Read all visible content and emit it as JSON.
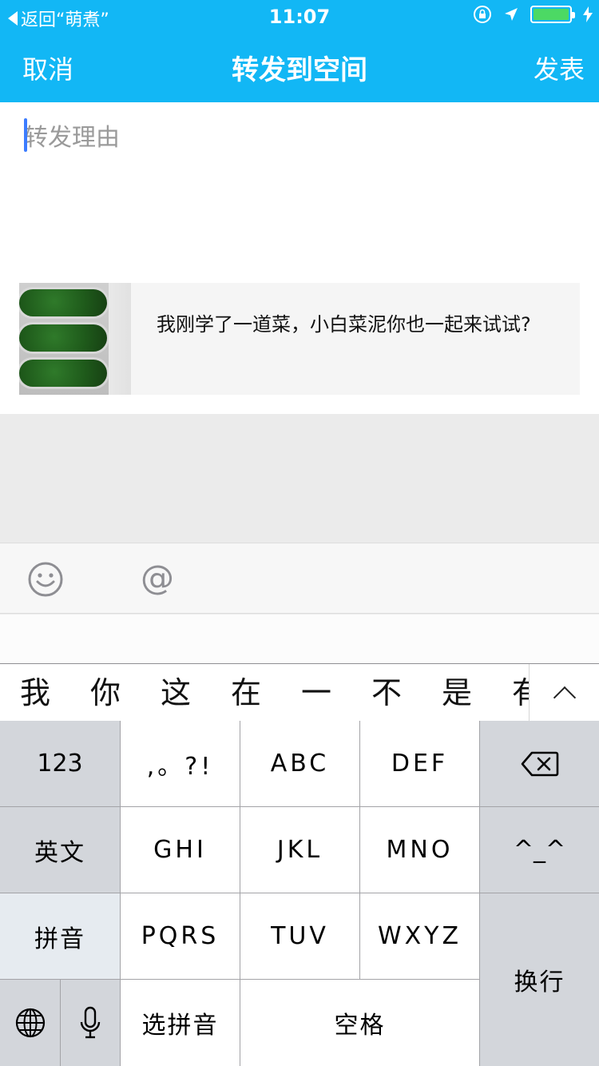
{
  "status_bar": {
    "back_label": "返回“萌煮”",
    "time": "11:07",
    "battery_color": "#4cd964"
  },
  "nav": {
    "cancel": "取消",
    "title": "转发到空间",
    "publish": "发表",
    "bg_color": "#12b7f5"
  },
  "composer": {
    "placeholder": "转发理由",
    "value": ""
  },
  "share_card": {
    "text": "我刚学了一道菜，小白菜泥你也一起来试试?"
  },
  "toolbar": {
    "icons": [
      "smiley-icon",
      "at-icon"
    ],
    "at_symbol": "@"
  },
  "candidates": [
    "我",
    "你",
    "这",
    "在",
    "一",
    "不",
    "是",
    "有"
  ],
  "keyboard": {
    "row1": [
      "123",
      ",。?!",
      "ABC",
      "DEF"
    ],
    "row2": [
      "英文",
      "GHI",
      "JKL",
      "MNO",
      "^_^"
    ],
    "row3": [
      "拼音",
      "PQRS",
      "TUV",
      "WXYZ"
    ],
    "row4": [
      "选拼音",
      "空格"
    ],
    "return": "换行"
  }
}
